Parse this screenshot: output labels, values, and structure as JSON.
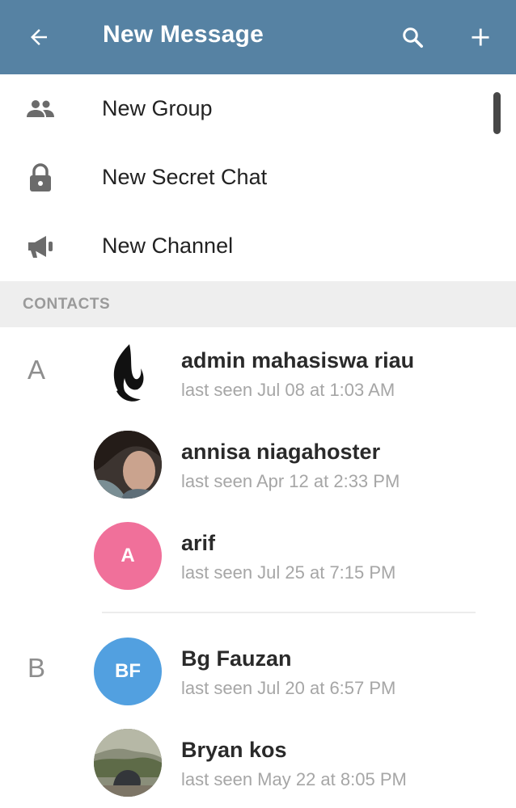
{
  "appbar": {
    "back_icon": "arrow-left-icon",
    "title": "New Message",
    "search_icon": "search-icon",
    "add_icon": "plus-icon",
    "color": "#5682a3"
  },
  "menu": [
    {
      "label": "New Group",
      "icon": "people-icon"
    },
    {
      "label": "New Secret Chat",
      "icon": "lock-icon"
    },
    {
      "label": "New Channel",
      "icon": "megaphone-icon"
    }
  ],
  "section": {
    "title": "CONTACTS"
  },
  "contacts": [
    {
      "letter": "A",
      "name": "admin mahasiswa riau",
      "status": "last seen Jul 08 at 1:03 AM",
      "avatar": "flame-logo"
    },
    {
      "letter": "",
      "name": "annisa niagahoster",
      "status": "last seen Apr 12 at 2:33 PM",
      "avatar": "photo"
    },
    {
      "letter": "",
      "name": "arif",
      "status": "last seen Jul 25 at 7:15 PM",
      "initials": "A",
      "avatar_color": "#f0709a"
    },
    {
      "letter": "B",
      "name": "Bg Fauzan",
      "status": "last seen Jul 20 at 6:57 PM",
      "initials": "BF",
      "avatar_color": "#52a0e0"
    },
    {
      "letter": "",
      "name": "Bryan kos",
      "status": "last seen May 22 at 8:05 PM",
      "avatar": "photo"
    }
  ]
}
